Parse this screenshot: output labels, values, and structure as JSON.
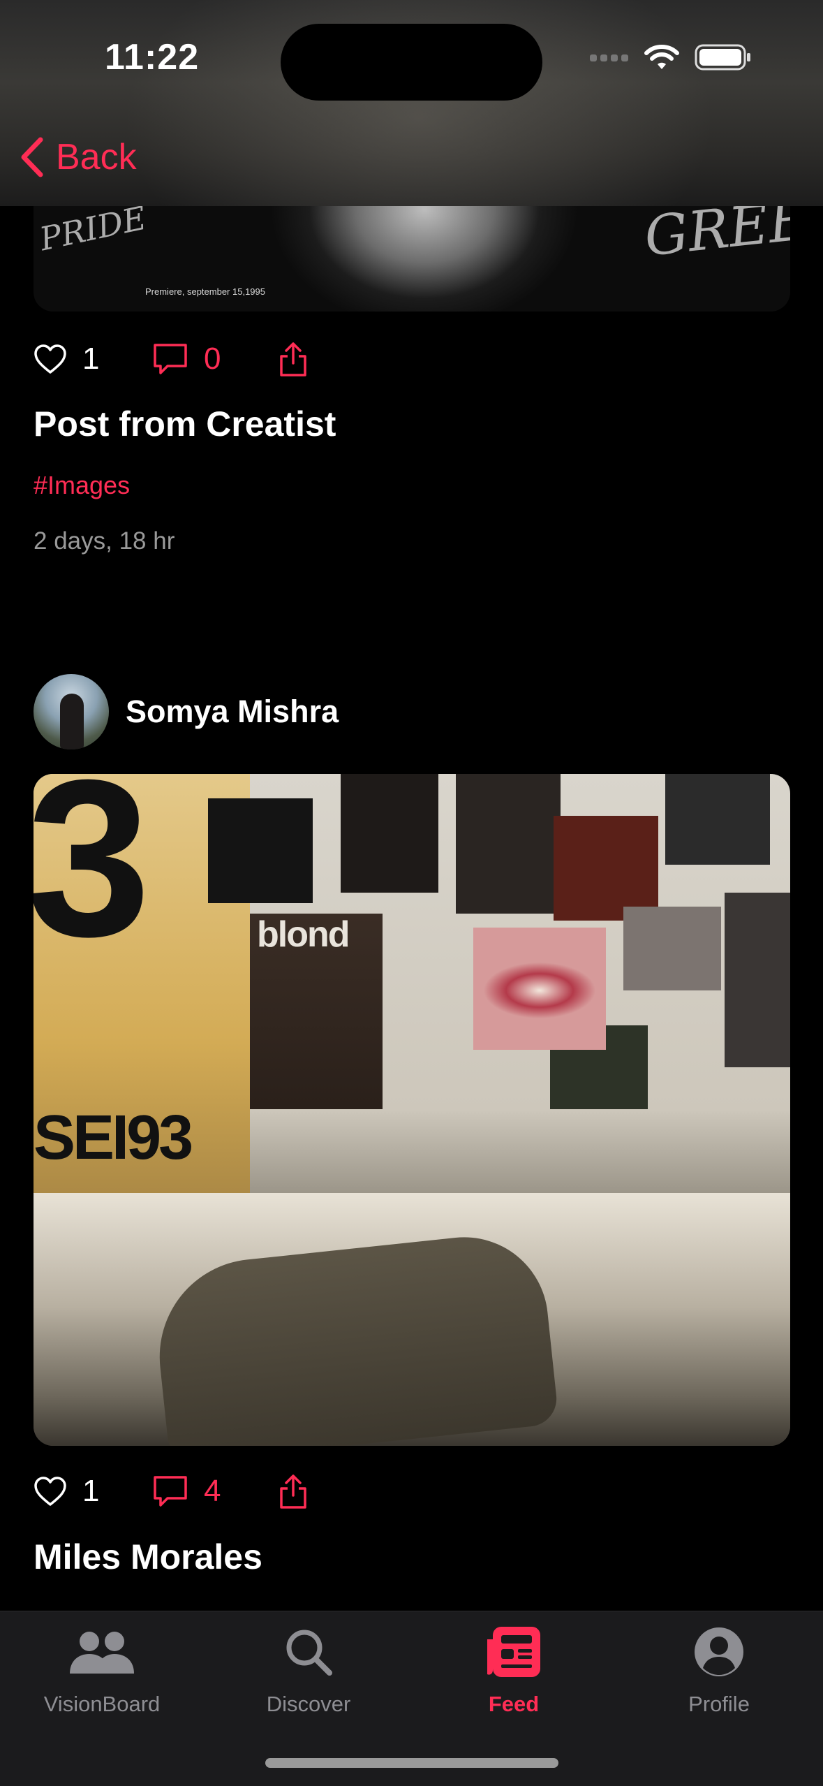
{
  "status_bar": {
    "time": "11:22"
  },
  "nav": {
    "back_label": "Back"
  },
  "posts": [
    {
      "image_text": {
        "left_scrawl": "PRIDE",
        "right_scrawl": "GREEY",
        "caption": "Premiere, september 15,1995"
      },
      "likes": "1",
      "comments": "0",
      "title": "Post from Creatist",
      "tag": "#Images",
      "time_ago": "2 days, 18 hr"
    },
    {
      "author": "Somya Mishra",
      "image_text": {
        "big_number": "3",
        "poster_word": "blond",
        "poster_sei": "SEI93"
      },
      "likes": "1",
      "comments": "4",
      "title": "Miles Morales"
    }
  ],
  "tab_bar": {
    "tabs": [
      {
        "label": "VisionBoard",
        "icon": "people-icon",
        "active": false
      },
      {
        "label": "Discover",
        "icon": "search-icon",
        "active": false
      },
      {
        "label": "Feed",
        "icon": "feed-icon",
        "active": true
      },
      {
        "label": "Profile",
        "icon": "profile-icon",
        "active": false
      }
    ]
  },
  "colors": {
    "accent": "#ff2d55",
    "background": "#000000",
    "tab_bar": "#1b1b1d",
    "secondary_text": "#9a9a9a"
  }
}
